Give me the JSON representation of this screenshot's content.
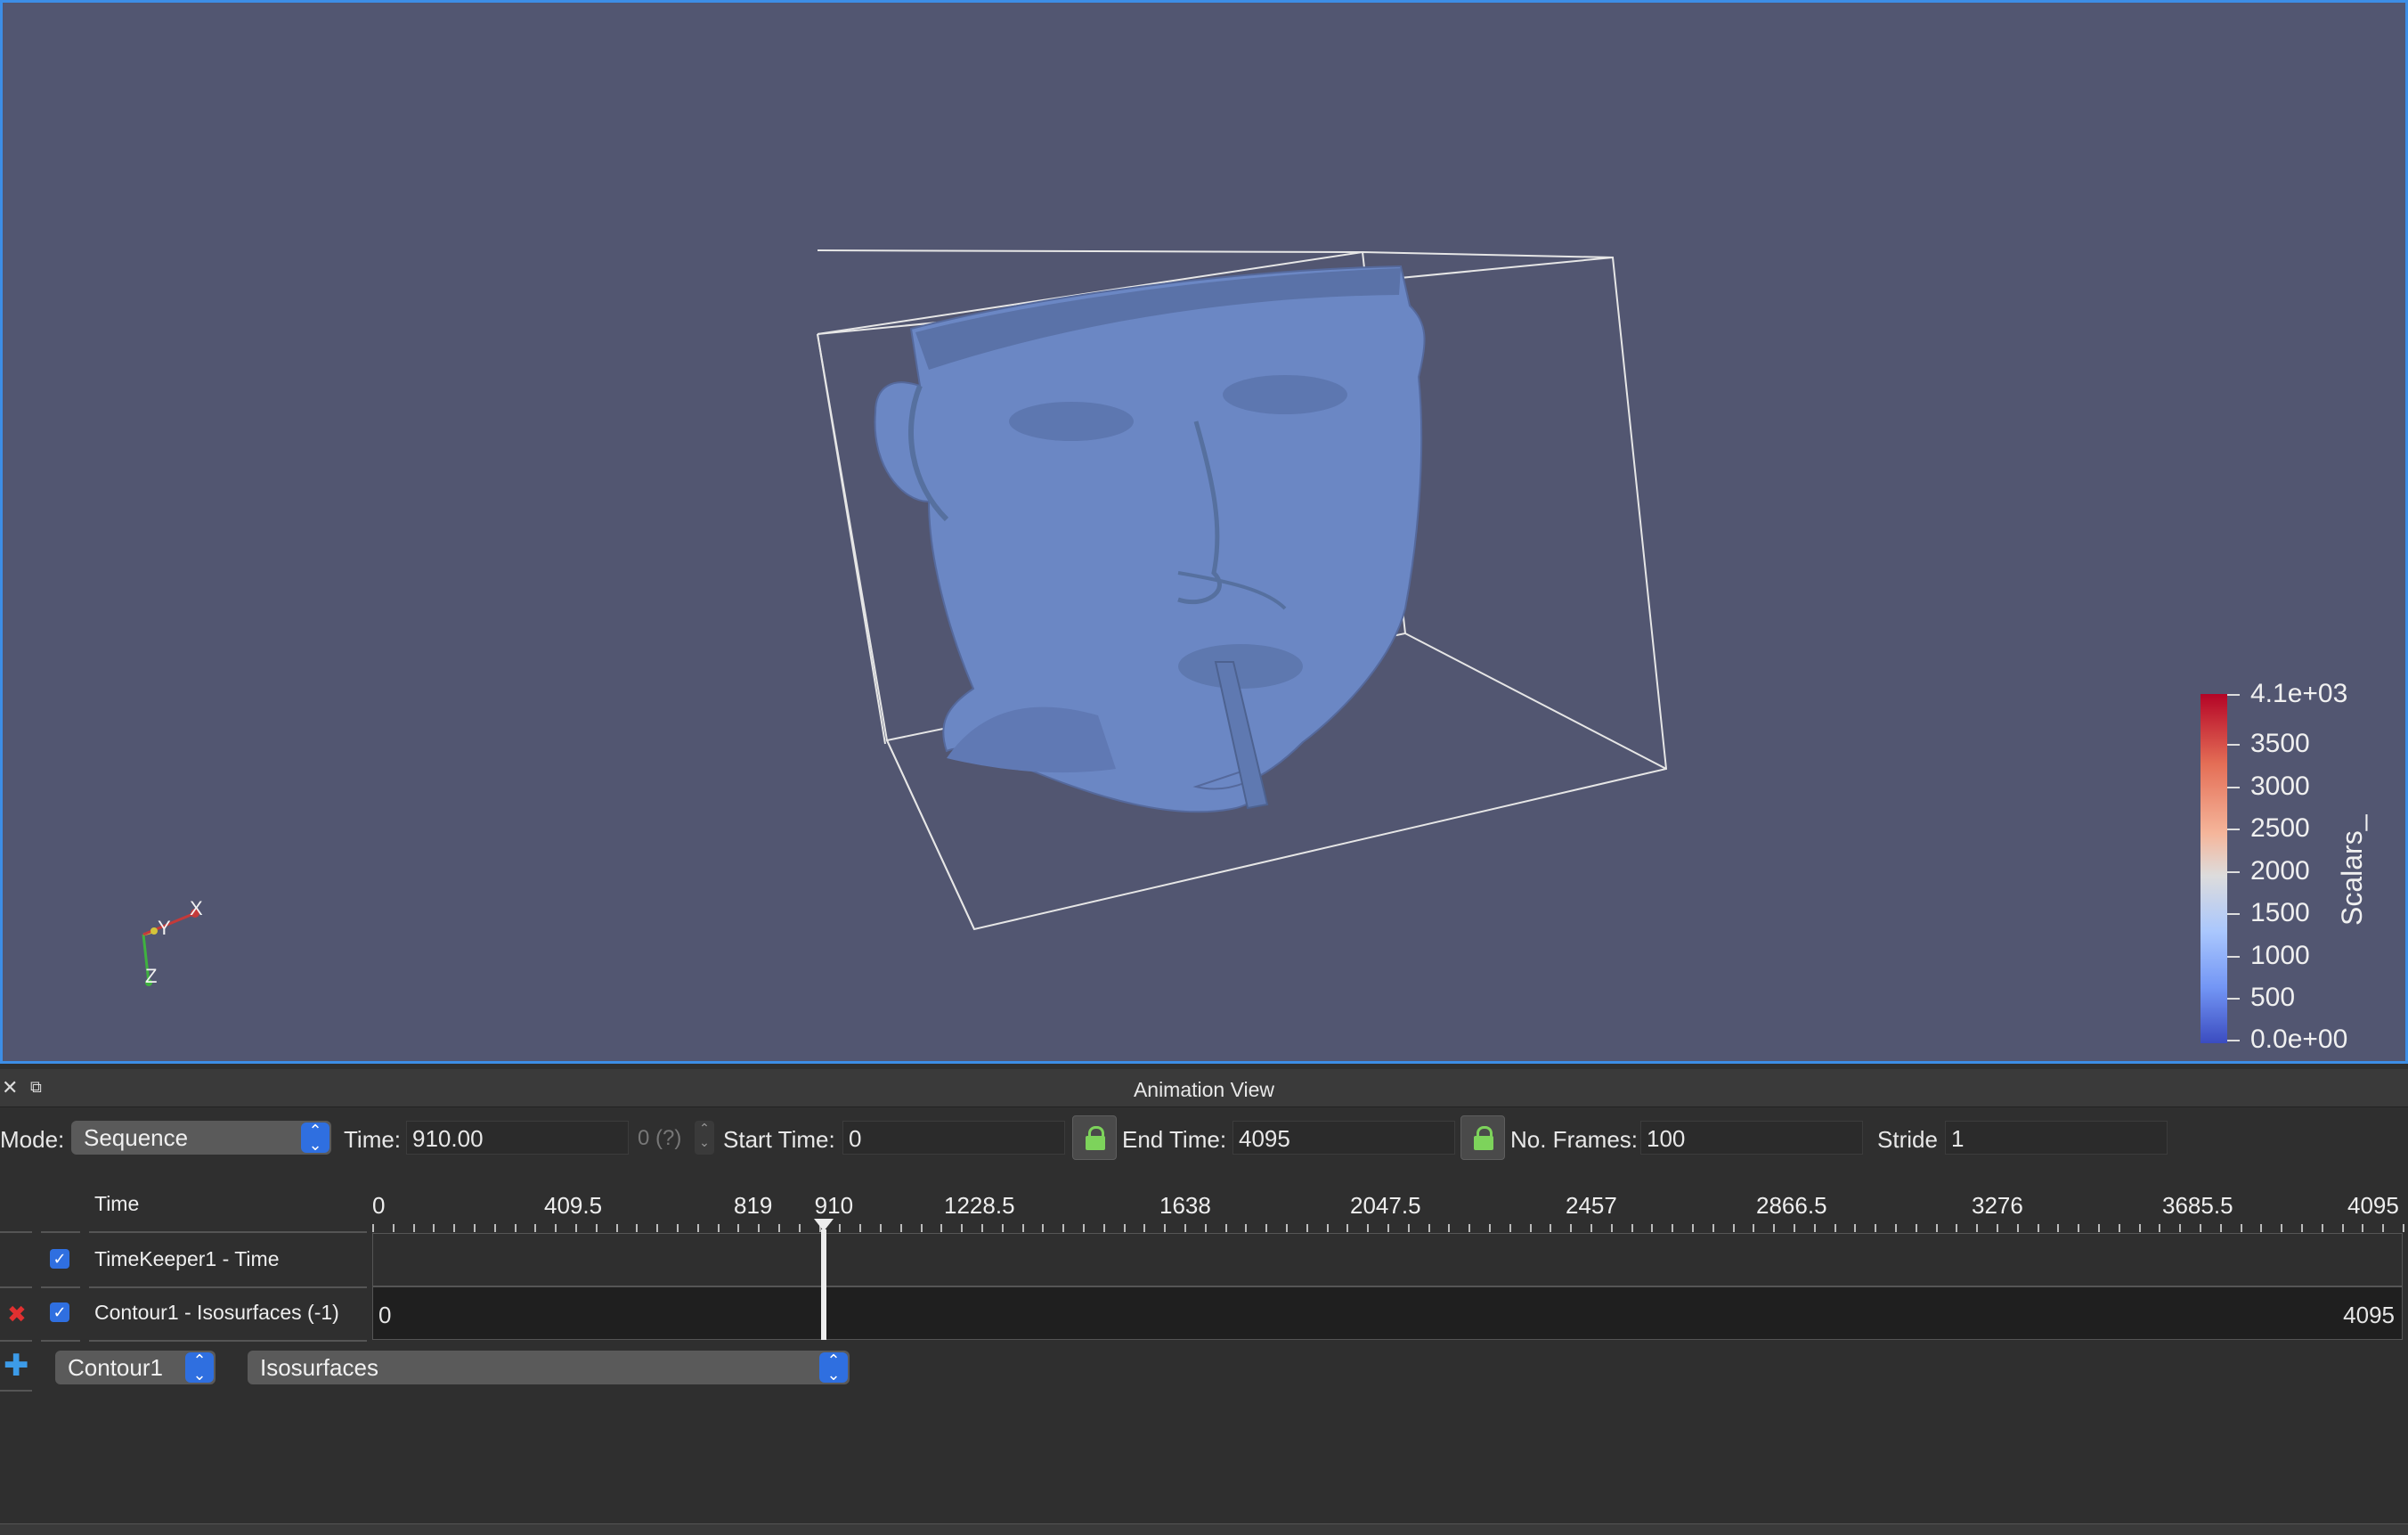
{
  "viewport": {
    "axes": {
      "x": "X",
      "y": "Y",
      "z": "Z"
    },
    "colorbar": {
      "title": "Scalars_",
      "labels": [
        "4.1e+03",
        "3500",
        "3000",
        "2500",
        "2000",
        "1500",
        "1000",
        "500",
        "0.0e+00"
      ],
      "range": [
        0,
        4095
      ],
      "colors": {
        "high": "#b40426",
        "mid": "#dddcdc",
        "low": "#3b4cc0"
      }
    },
    "background_color": "#525671",
    "surface_color": "#6b87c4"
  },
  "animation_view": {
    "title": "Animation View",
    "close_icon": "close-icon",
    "float_icon": "float-icon",
    "toolbar": {
      "mode_label": "Mode:",
      "mode_value": "Sequence",
      "time_label": "Time:",
      "time_value": "910.00",
      "time_index": "0 (?)",
      "start_time_label": "Start Time:",
      "start_time_value": "0",
      "end_time_label": "End Time:",
      "end_time_value": "4095",
      "frames_label": "No. Frames:",
      "frames_value": "100",
      "stride_label": "Stride",
      "stride_value": "1"
    },
    "timeline": {
      "header": "Time",
      "ticks": [
        "0",
        "409.5",
        "819",
        "910",
        "1228.5",
        "1638",
        "2047.5",
        "2457",
        "2866.5",
        "3276",
        "3685.5",
        "4095"
      ],
      "current_time": 910,
      "range": [
        0,
        4095
      ],
      "tracks": [
        {
          "label": "TimeKeeper1 - Time",
          "checked": true
        },
        {
          "label": "Contour1 - Isosurfaces (-1)",
          "checked": true,
          "start": "0",
          "end": "4095"
        }
      ]
    },
    "add_row": {
      "source_value": "Contour1",
      "property_value": "Isosurfaces"
    }
  }
}
